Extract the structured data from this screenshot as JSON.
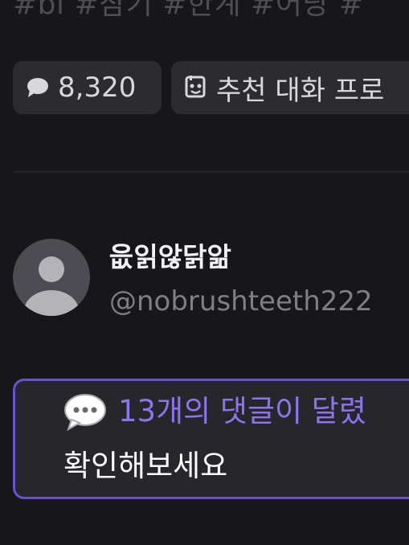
{
  "tags_text": "#bl #참기 #한계 #어당 #",
  "chips": {
    "comments": {
      "icon": "chat-bubble-icon",
      "count": "8,320"
    },
    "recommend": {
      "icon": "robot-face-icon",
      "label": "추천 대화 프로"
    }
  },
  "profile": {
    "avatar_icon": "default-user-avatar-icon",
    "display_name": "읎읽않닭앎",
    "handle": "@nobrushteeth222"
  },
  "notice": {
    "icon": "speech-bubble-icon",
    "title": "13개의 댓글이 달렸",
    "body": "확인해보세요"
  },
  "colors": {
    "background": "#171618",
    "chip_bg": "#2c2b2f",
    "accent_border": "#6b4fd1",
    "accent_text": "#8d74ee",
    "muted_text": "#7f7d86"
  }
}
